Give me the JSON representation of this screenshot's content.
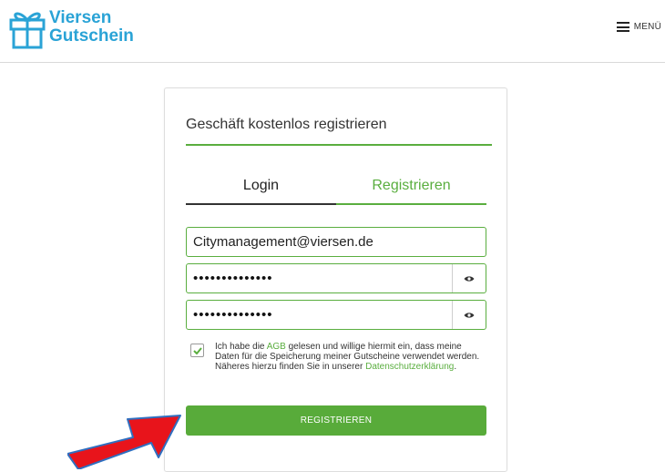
{
  "header": {
    "logo_line1": "Viersen",
    "logo_line2": "Gutschein",
    "menu_label": "MENÜ"
  },
  "card": {
    "title": "Geschäft kostenlos registrieren",
    "tabs": [
      {
        "label": "Login",
        "active": false
      },
      {
        "label": "Registrieren",
        "active": true
      }
    ],
    "email_value": "Citymanagement@viersen.de",
    "password_value": "••••••••••••••",
    "password_confirm_value": "••••••••••••••",
    "consent": {
      "checked": true,
      "text_before": "Ich habe die ",
      "agb_link": "AGB",
      "text_middle": " gelesen und willige hiermit ein, dass meine Daten für die Speicherung meiner Gutscheine verwendet werden. Näheres hierzu finden Sie in unserer ",
      "privacy_link": "Datenschutzerklärung",
      "text_after": "."
    },
    "submit_label": "REGISTRIEREN"
  },
  "colors": {
    "brand_blue": "#2aa3d6",
    "accent_green": "#5aae3f",
    "arrow_red": "#e8141b",
    "arrow_outline": "#2f6fc0"
  }
}
